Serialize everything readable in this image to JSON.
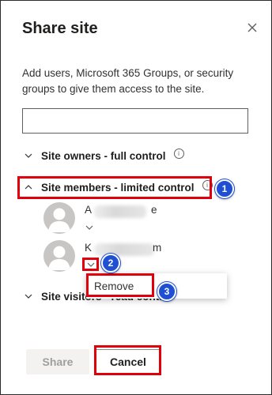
{
  "panel": {
    "title": "Share site",
    "description": "Add users, Microsoft 365 Groups, or security groups to give them access to the site.",
    "input_value": "",
    "input_placeholder": ""
  },
  "sections": {
    "owners": {
      "label": "Site owners - full control",
      "expanded": false
    },
    "members": {
      "label": "Site members - limited control",
      "expanded": true
    },
    "visitors": {
      "label": "Site visitors - read control",
      "expanded": false
    }
  },
  "members": [
    {
      "name_start": "A",
      "name_end": "e"
    },
    {
      "name_start": "K",
      "name_end": "m"
    }
  ],
  "permission_menu": {
    "items": [
      "Remove"
    ]
  },
  "buttons": {
    "share": "Share",
    "cancel": "Cancel"
  },
  "annotations": [
    "1",
    "2",
    "3"
  ],
  "colors": {
    "highlight": "#e0000b",
    "badge": "#1f4fd3",
    "disabled_text": "#a19f9d"
  },
  "icons": {
    "close": "close-icon",
    "info": "info-icon",
    "chevron_down": "chevron-down-icon",
    "chevron_up": "chevron-up-icon",
    "avatar": "person-icon"
  }
}
